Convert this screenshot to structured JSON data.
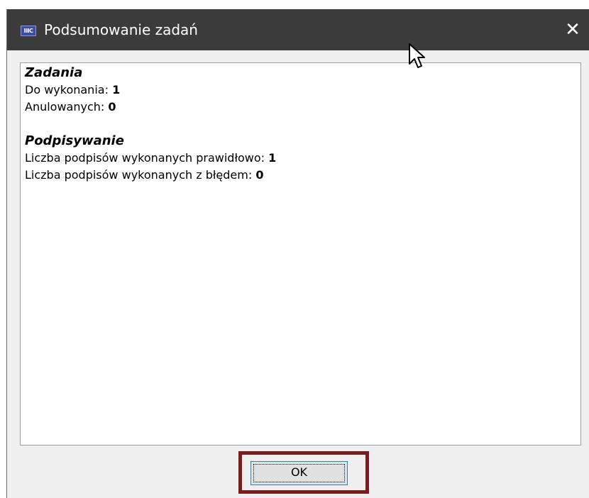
{
  "window": {
    "title": "Podsumowanie zadań",
    "app_icon_label": "IIIC",
    "close_symbol": "✕"
  },
  "summary": {
    "tasks": {
      "heading": "Zadania",
      "to_do_label": "Do wykonania:",
      "to_do_value": "1",
      "cancelled_label": "Anulowanych:",
      "cancelled_value": "0"
    },
    "signing": {
      "heading": "Podpisywanie",
      "ok_label": "Liczba podpisów wykonanych prawidłowo:",
      "ok_value": "1",
      "error_label": "Liczba podpisów wykonanych z błędem:",
      "error_value": "0"
    }
  },
  "buttons": {
    "ok_label": "OK"
  },
  "colors": {
    "titlebar": "#3b3b3b",
    "highlight_border": "#7a1c1c",
    "button_focus": "#3c7fb1"
  }
}
